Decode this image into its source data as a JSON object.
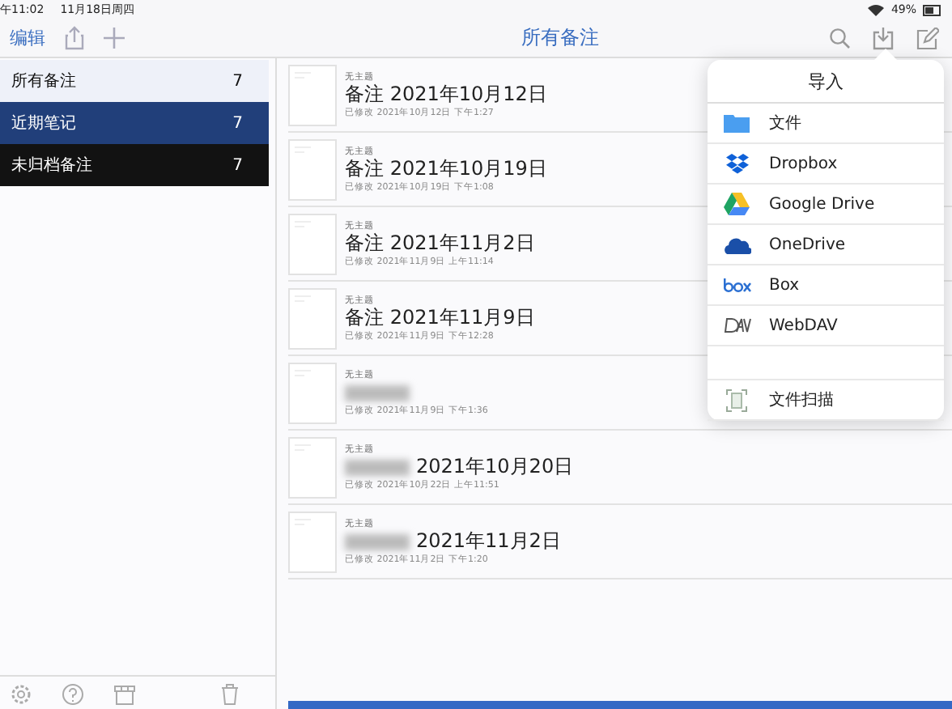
{
  "status_bar": {
    "time": "午11:02",
    "date": "11月18日周四",
    "battery": "49%"
  },
  "toolbar": {
    "edit": "编辑",
    "title": "所有备注"
  },
  "sidebar": {
    "items": [
      {
        "label": "所有备注",
        "count": "7",
        "kind": "light"
      },
      {
        "label": "近期笔记",
        "count": "7",
        "kind": "blue"
      },
      {
        "label": "未归档备注",
        "count": "7",
        "kind": "dark"
      }
    ]
  },
  "notes": [
    {
      "subject": "无主题",
      "title": "备注 2021年10月12日",
      "redacted": false,
      "modified": "已修改 2021年10月12日 下午1:27"
    },
    {
      "subject": "无主题",
      "title": "备注 2021年10月19日",
      "redacted": false,
      "modified": "已修改 2021年10月19日 下午1:08"
    },
    {
      "subject": "无主题",
      "title": "备注 2021年11月2日",
      "redacted": false,
      "modified": "已修改 2021年11月9日 上午11:14"
    },
    {
      "subject": "无主题",
      "title": "备注 2021年11月9日",
      "redacted": false,
      "modified": "已修改 2021年11月9日 下午12:28"
    },
    {
      "subject": "无主题",
      "redacted": true,
      "modified": "已修改 2021年11月9日 下午1:36"
    },
    {
      "subject": "无主题",
      "title": "2021年10月20日",
      "redacted": true,
      "modified": "已修改 2021年10月22日 上午11:51"
    },
    {
      "subject": "无主题",
      "title": "2021年11月2日",
      "redacted": true,
      "modified": "已修改 2021年11月2日 下午1:20"
    }
  ],
  "import_menu": {
    "title": "导入",
    "items": [
      {
        "label": "文件",
        "kind": "folder"
      },
      {
        "label": "Dropbox",
        "kind": "dropbox"
      },
      {
        "label": "Google Drive",
        "kind": "gdrive"
      },
      {
        "label": "OneDrive",
        "kind": "onedrive"
      },
      {
        "label": "Box",
        "kind": "box"
      },
      {
        "label": "WebDAV",
        "kind": "webdav"
      }
    ],
    "scan": "文件扫描"
  }
}
